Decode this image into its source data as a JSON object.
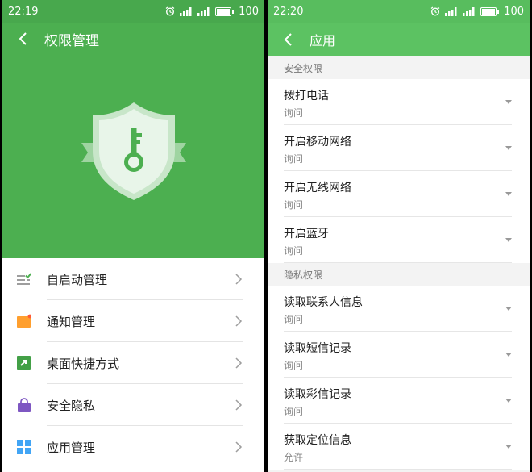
{
  "left": {
    "status": {
      "time": "22:19",
      "battery": "100",
      "network": "4G"
    },
    "title": "权限管理",
    "menu": [
      {
        "label": "自启动管理",
        "icon": "autostart-icon"
      },
      {
        "label": "通知管理",
        "icon": "notification-icon"
      },
      {
        "label": "桌面快捷方式",
        "icon": "shortcut-icon"
      },
      {
        "label": "安全隐私",
        "icon": "privacy-lock-icon"
      },
      {
        "label": "应用管理",
        "icon": "apps-grid-icon"
      }
    ]
  },
  "right": {
    "status": {
      "time": "22:20",
      "battery": "100",
      "network": "4G"
    },
    "title": "应用",
    "sections": [
      {
        "header": "安全权限",
        "items": [
          {
            "name": "拨打电话",
            "value": "询问"
          },
          {
            "name": "开启移动网络",
            "value": "询问"
          },
          {
            "name": "开启无线网络",
            "value": "询问"
          },
          {
            "name": "开启蓝牙",
            "value": "询问"
          }
        ]
      },
      {
        "header": "隐私权限",
        "items": [
          {
            "name": "读取联系人信息",
            "value": "询问"
          },
          {
            "name": "读取短信记录",
            "value": "询问"
          },
          {
            "name": "读取彩信记录",
            "value": "询问"
          },
          {
            "name": "获取定位信息",
            "value": "允许"
          }
        ]
      }
    ]
  },
  "colors": {
    "green": "#4caf50",
    "light_green": "#5cc262"
  }
}
